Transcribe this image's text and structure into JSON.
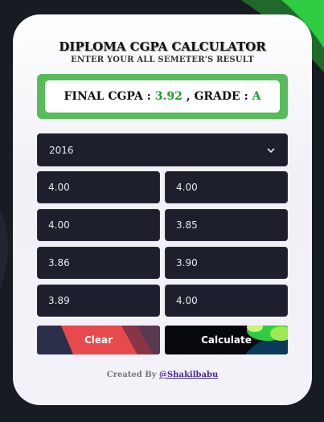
{
  "app": {
    "title": "DIPLOMA CGPA CALCULATOR",
    "subtitle": "ENTER YOUR ALL SEMETER'S RESULT"
  },
  "result": {
    "cgpa_label": "FINAL CGPA :",
    "cgpa_value": "3.92",
    "separator": ", GRADE :",
    "grade_value": "A",
    "accent_color": "#1e9b2f"
  },
  "regulation_select": {
    "selected": "2016",
    "icon": "chevron-down-icon"
  },
  "semesters": {
    "values": [
      "4.00",
      "4.00",
      "4.00",
      "3.85",
      "3.86",
      "3.90",
      "3.89",
      "4.00"
    ]
  },
  "buttons": {
    "clear_label": "Clear",
    "calculate_label": "Calculate"
  },
  "footer": {
    "created_by": "Created By",
    "author": "@Shakilbabu"
  },
  "colors": {
    "background": "#171b22",
    "card": "#f3f2f8",
    "result_border": "#58bc5b",
    "input_bg": "#1e1f2c",
    "clear_red": "#e64a4d",
    "calc_green": "#2ecc40"
  }
}
